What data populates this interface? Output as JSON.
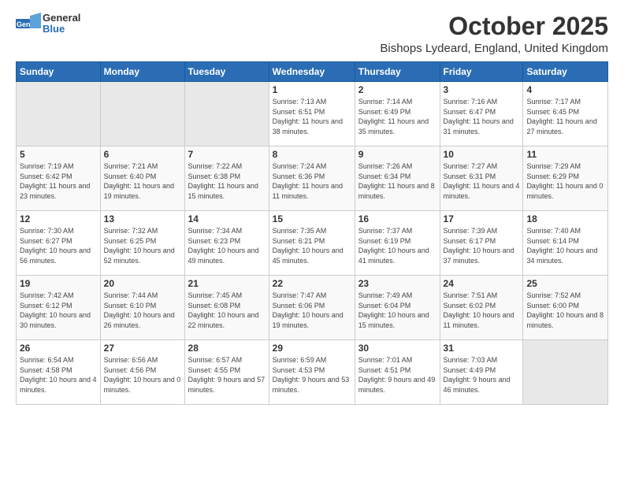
{
  "header": {
    "logo_general": "General",
    "logo_blue": "Blue",
    "month_title": "October 2025",
    "location": "Bishops Lydeard, England, United Kingdom"
  },
  "weekdays": [
    "Sunday",
    "Monday",
    "Tuesday",
    "Wednesday",
    "Thursday",
    "Friday",
    "Saturday"
  ],
  "weeks": [
    [
      {
        "day": "",
        "empty": true
      },
      {
        "day": "",
        "empty": true
      },
      {
        "day": "",
        "empty": true
      },
      {
        "day": "1",
        "sunrise": "7:13 AM",
        "sunset": "6:51 PM",
        "daylight": "11 hours and 38 minutes."
      },
      {
        "day": "2",
        "sunrise": "7:14 AM",
        "sunset": "6:49 PM",
        "daylight": "11 hours and 35 minutes."
      },
      {
        "day": "3",
        "sunrise": "7:16 AM",
        "sunset": "6:47 PM",
        "daylight": "11 hours and 31 minutes."
      },
      {
        "day": "4",
        "sunrise": "7:17 AM",
        "sunset": "6:45 PM",
        "daylight": "11 hours and 27 minutes."
      }
    ],
    [
      {
        "day": "5",
        "sunrise": "7:19 AM",
        "sunset": "6:42 PM",
        "daylight": "11 hours and 23 minutes."
      },
      {
        "day": "6",
        "sunrise": "7:21 AM",
        "sunset": "6:40 PM",
        "daylight": "11 hours and 19 minutes."
      },
      {
        "day": "7",
        "sunrise": "7:22 AM",
        "sunset": "6:38 PM",
        "daylight": "11 hours and 15 minutes."
      },
      {
        "day": "8",
        "sunrise": "7:24 AM",
        "sunset": "6:36 PM",
        "daylight": "11 hours and 11 minutes."
      },
      {
        "day": "9",
        "sunrise": "7:26 AM",
        "sunset": "6:34 PM",
        "daylight": "11 hours and 8 minutes."
      },
      {
        "day": "10",
        "sunrise": "7:27 AM",
        "sunset": "6:31 PM",
        "daylight": "11 hours and 4 minutes."
      },
      {
        "day": "11",
        "sunrise": "7:29 AM",
        "sunset": "6:29 PM",
        "daylight": "11 hours and 0 minutes."
      }
    ],
    [
      {
        "day": "12",
        "sunrise": "7:30 AM",
        "sunset": "6:27 PM",
        "daylight": "10 hours and 56 minutes."
      },
      {
        "day": "13",
        "sunrise": "7:32 AM",
        "sunset": "6:25 PM",
        "daylight": "10 hours and 52 minutes."
      },
      {
        "day": "14",
        "sunrise": "7:34 AM",
        "sunset": "6:23 PM",
        "daylight": "10 hours and 49 minutes."
      },
      {
        "day": "15",
        "sunrise": "7:35 AM",
        "sunset": "6:21 PM",
        "daylight": "10 hours and 45 minutes."
      },
      {
        "day": "16",
        "sunrise": "7:37 AM",
        "sunset": "6:19 PM",
        "daylight": "10 hours and 41 minutes."
      },
      {
        "day": "17",
        "sunrise": "7:39 AM",
        "sunset": "6:17 PM",
        "daylight": "10 hours and 37 minutes."
      },
      {
        "day": "18",
        "sunrise": "7:40 AM",
        "sunset": "6:14 PM",
        "daylight": "10 hours and 34 minutes."
      }
    ],
    [
      {
        "day": "19",
        "sunrise": "7:42 AM",
        "sunset": "6:12 PM",
        "daylight": "10 hours and 30 minutes."
      },
      {
        "day": "20",
        "sunrise": "7:44 AM",
        "sunset": "6:10 PM",
        "daylight": "10 hours and 26 minutes."
      },
      {
        "day": "21",
        "sunrise": "7:45 AM",
        "sunset": "6:08 PM",
        "daylight": "10 hours and 22 minutes."
      },
      {
        "day": "22",
        "sunrise": "7:47 AM",
        "sunset": "6:06 PM",
        "daylight": "10 hours and 19 minutes."
      },
      {
        "day": "23",
        "sunrise": "7:49 AM",
        "sunset": "6:04 PM",
        "daylight": "10 hours and 15 minutes."
      },
      {
        "day": "24",
        "sunrise": "7:51 AM",
        "sunset": "6:02 PM",
        "daylight": "10 hours and 11 minutes."
      },
      {
        "day": "25",
        "sunrise": "7:52 AM",
        "sunset": "6:00 PM",
        "daylight": "10 hours and 8 minutes."
      }
    ],
    [
      {
        "day": "26",
        "sunrise": "6:54 AM",
        "sunset": "4:58 PM",
        "daylight": "10 hours and 4 minutes."
      },
      {
        "day": "27",
        "sunrise": "6:56 AM",
        "sunset": "4:56 PM",
        "daylight": "10 hours and 0 minutes."
      },
      {
        "day": "28",
        "sunrise": "6:57 AM",
        "sunset": "4:55 PM",
        "daylight": "9 hours and 57 minutes."
      },
      {
        "day": "29",
        "sunrise": "6:59 AM",
        "sunset": "4:53 PM",
        "daylight": "9 hours and 53 minutes."
      },
      {
        "day": "30",
        "sunrise": "7:01 AM",
        "sunset": "4:51 PM",
        "daylight": "9 hours and 49 minutes."
      },
      {
        "day": "31",
        "sunrise": "7:03 AM",
        "sunset": "4:49 PM",
        "daylight": "9 hours and 46 minutes."
      },
      {
        "day": "",
        "empty": true
      }
    ]
  ],
  "labels": {
    "sunrise": "Sunrise:",
    "sunset": "Sunset:",
    "daylight": "Daylight:"
  }
}
